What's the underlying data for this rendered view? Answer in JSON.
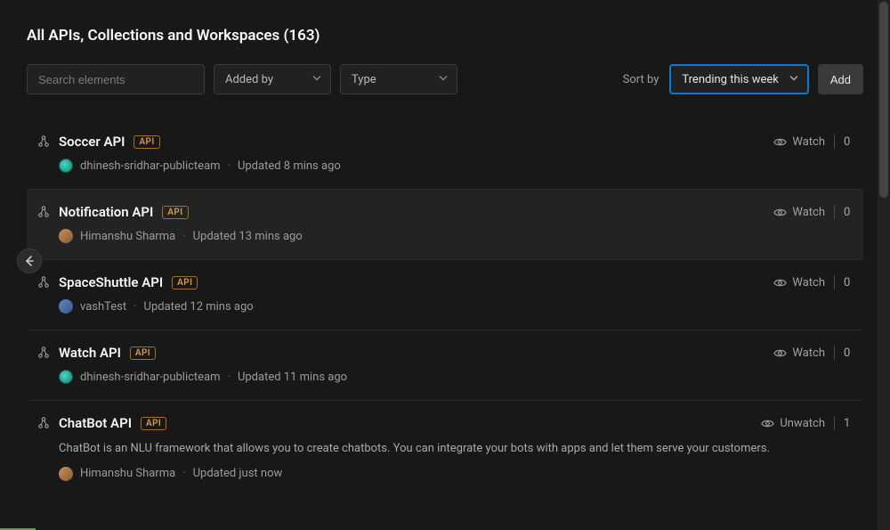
{
  "header": {
    "title": "All APIs, Collections and Workspaces (163)"
  },
  "filters": {
    "search_placeholder": "Search elements",
    "added_by_label": "Added by",
    "type_label": "Type"
  },
  "sort": {
    "label": "Sort by",
    "selected": "Trending this week"
  },
  "actions": {
    "add_label": "Add"
  },
  "watch_label": "Watch",
  "unwatch_label": "Unwatch",
  "items": [
    {
      "title": "Soccer API",
      "badge": "API",
      "author": "dhinesh-sridhar-publicteam",
      "updated": "Updated 8 mins ago",
      "watch": "Watch",
      "count": "0",
      "avatar_class": "teal"
    },
    {
      "title": "Notification API",
      "badge": "API",
      "author": "Himanshu Sharma",
      "updated": "Updated 13 mins ago",
      "watch": "Watch",
      "count": "0",
      "avatar_class": "photo",
      "highlighted": true
    },
    {
      "title": "SpaceShuttle API",
      "badge": "API",
      "author": "vashTest",
      "updated": "Updated 12 mins ago",
      "watch": "Watch",
      "count": "0",
      "avatar_class": "cool"
    },
    {
      "title": "Watch API",
      "badge": "API",
      "author": "dhinesh-sridhar-publicteam",
      "updated": "Updated 11 mins ago",
      "watch": "Watch",
      "count": "0",
      "avatar_class": "teal"
    },
    {
      "title": "ChatBot API",
      "badge": "API",
      "description": "ChatBot is an NLU framework that allows you to create chatbots. You can integrate your bots with apps and let them serve your customers.",
      "author": "Himanshu Sharma",
      "updated": "Updated just now",
      "watch": "Unwatch",
      "count": "1",
      "avatar_class": "photo"
    }
  ]
}
